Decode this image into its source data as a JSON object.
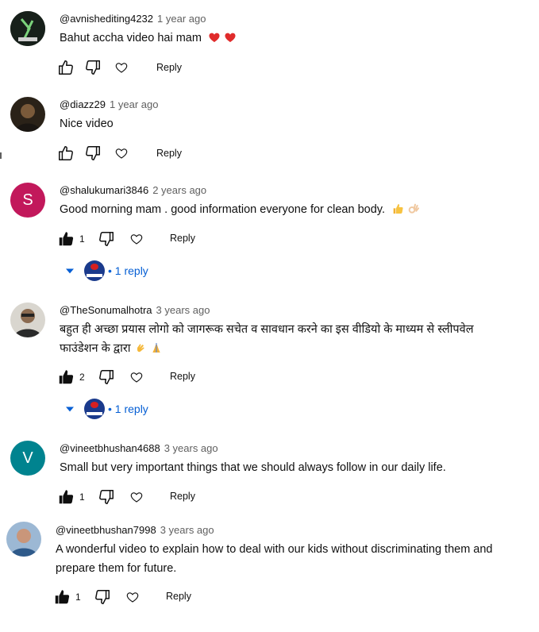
{
  "comments": [
    {
      "author": "@avnishediting4232",
      "time": "1 year ago",
      "text": "Bahut accha video hai mam",
      "emoji": [
        "red-heart",
        "red-heart"
      ],
      "likes": "",
      "liked": false,
      "reply_label": "Reply",
      "avatar": {
        "type": "image",
        "color": "#1f2a1f",
        "letter": ""
      }
    },
    {
      "author": "@diazz29",
      "time": "1 year ago",
      "text": "Nice video",
      "emoji": [],
      "likes": "",
      "liked": false,
      "reply_label": "Reply",
      "avatar": {
        "type": "image",
        "color": "#2b2620",
        "letter": ""
      }
    },
    {
      "author": "@shalukumari3846",
      "time": "2 years ago",
      "text": "Good morning mam . good information everyone for clean body.",
      "emoji": [
        "thumbs-up",
        "ok-hand"
      ],
      "likes": "1",
      "liked": true,
      "reply_label": "Reply",
      "avatar": {
        "type": "letter",
        "color": "#c2185b",
        "letter": "S"
      },
      "replies_label": "• 1 reply"
    },
    {
      "author": "@TheSonumalhotra",
      "time": "3 years ago",
      "text_lines": [
        "बहुत ही अच्छा प्रयास लोगो को जागरूक सचेत व सावधान करने का इस वीडियो के माध्यम से  स्लीपवेल",
        "फाउंडेशन के द्वारा"
      ],
      "emoji": [
        "clapping-hands",
        "folded-hands"
      ],
      "likes": "2",
      "liked": true,
      "reply_label": "Reply",
      "avatar": {
        "type": "image",
        "color": "#4a4640",
        "letter": ""
      },
      "replies_label": "• 1 reply"
    },
    {
      "author": "@vineetbhushan4688",
      "time": "3 years ago",
      "text": "Small but very important things that we should always follow in our daily life.",
      "emoji": [],
      "likes": "1",
      "liked": true,
      "reply_label": "Reply",
      "avatar": {
        "type": "letter",
        "color": "#00838f",
        "letter": "V"
      }
    },
    {
      "author": "@vineetbhushan7998",
      "time": "3 years ago",
      "text_lines": [
        "A wonderful video to explain how to deal with our kids without discriminating them and",
        "prepare them for future."
      ],
      "emoji": [],
      "likes": "1",
      "liked": true,
      "reply_label": "Reply",
      "avatar": {
        "type": "image",
        "color": "#5b7fa0",
        "letter": ""
      }
    }
  ],
  "colors": {
    "link": "#065fd4",
    "meta": "#606060",
    "text": "#0f0f0f"
  }
}
